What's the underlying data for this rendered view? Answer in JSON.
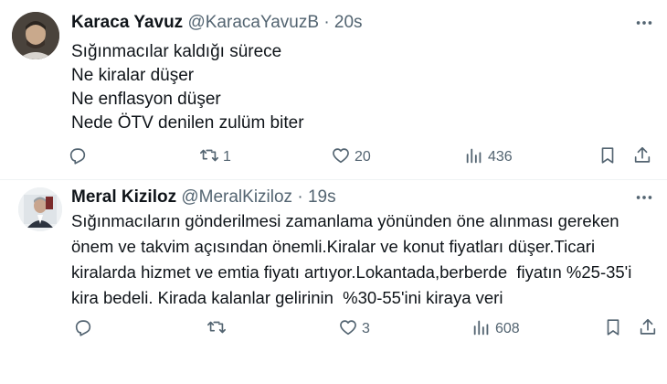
{
  "tweets": [
    {
      "name": "Karaca Yavuz",
      "handle": "@KaracaYavuzB",
      "separator": "·",
      "time": "20s",
      "text": "Sığınmacılar kaldığı sürece\nNe kiralar düşer\nNe enflasyon düşer\nNede ÖTV denilen zulüm biter",
      "reply_count": "",
      "retweet_count": "1",
      "like_count": "20",
      "view_count": "436"
    },
    {
      "name": "Meral Kiziloz",
      "handle": "@MeralKiziloz",
      "separator": "·",
      "time": "19s",
      "text": "Sığınmacıların gönderilmesi zamanlama yönünden öne alınması gereken önem ve takvim açısından önemli.Kiralar ve konut fiyatları düşer.Ticari kiralarda hizmet ve emtia fiyatı artıyor.Lokantada,berberde  fiyatın %25-35'i kira bedeli. Kirada kalanlar gelirinin  %30-55'ini kiraya veri",
      "reply_count": "",
      "retweet_count": "",
      "like_count": "3",
      "view_count": "608"
    }
  ],
  "icons": {
    "reply": "reply-icon",
    "retweet": "retweet-icon",
    "like": "heart-icon",
    "views": "views-icon",
    "bookmark": "bookmark-icon",
    "share": "share-icon",
    "more": "more-icon"
  },
  "colors": {
    "text": "#0f1419",
    "secondary": "#536471",
    "divider": "#eff3f4"
  }
}
